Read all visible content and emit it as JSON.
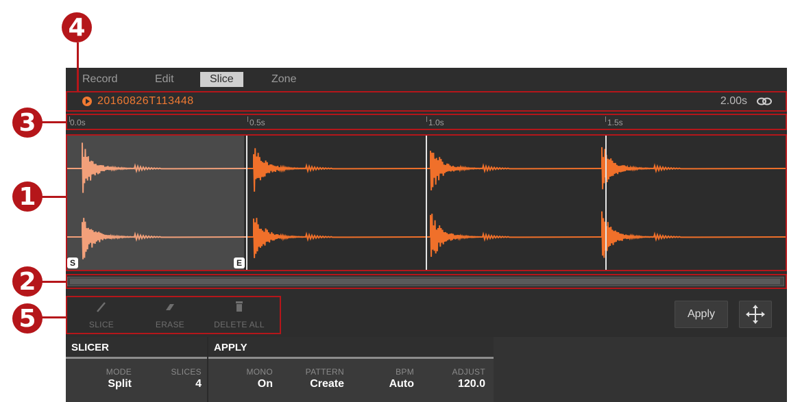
{
  "callouts": [
    "4",
    "3",
    "1",
    "2",
    "5"
  ],
  "tabs": [
    {
      "label": "Record",
      "active": false
    },
    {
      "label": "Edit",
      "active": false
    },
    {
      "label": "Slice",
      "active": true
    },
    {
      "label": "Zone",
      "active": false
    }
  ],
  "file": {
    "name": "20160826T113448",
    "duration": "2.00s",
    "play_icon": "play-icon",
    "link_icon": "link-icon"
  },
  "ruler": {
    "labels": [
      "0.0s",
      "0.5s",
      "1.0s",
      "1.5s"
    ]
  },
  "waveform": {
    "markers": {
      "start": "S",
      "end": "E"
    },
    "colors": {
      "selected": "#f2a07a",
      "slices": "#f0702a",
      "slice_line": "#e6e6e6"
    },
    "slices": 4
  },
  "tools": [
    {
      "label": "SLICE",
      "icon": "pen-icon"
    },
    {
      "label": "ERASE",
      "icon": "eraser-icon"
    },
    {
      "label": "DELETE ALL",
      "icon": "trash-icon"
    }
  ],
  "buttons": {
    "apply": "Apply",
    "move_icon": "move-icon"
  },
  "sections": {
    "slicer": {
      "title": "SLICER",
      "params": [
        {
          "name": "MODE",
          "value": "Split"
        },
        {
          "name": "SLICES",
          "value": "4"
        }
      ]
    },
    "apply": {
      "title": "APPLY",
      "params": [
        {
          "name": "MONO",
          "value": "On"
        },
        {
          "name": "PATTERN",
          "value": "Create"
        },
        {
          "name": "BPM",
          "value": "Auto"
        },
        {
          "name": "ADJUST",
          "value": "120.0"
        }
      ]
    }
  },
  "accent_color": "#f07a32",
  "callout_color": "#b5161a"
}
